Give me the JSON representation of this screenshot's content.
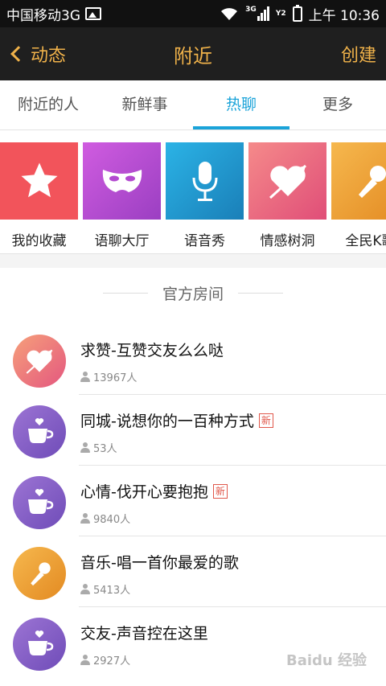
{
  "status": {
    "carrier": "中国移动3G",
    "time": "上午 10:36",
    "net_top": "3G",
    "net2": "Y2"
  },
  "header": {
    "back_label": "动态",
    "title": "附近",
    "create_label": "创建"
  },
  "tabs": [
    {
      "label": "附近的人"
    },
    {
      "label": "新鲜事"
    },
    {
      "label": "热聊"
    },
    {
      "label": "更多"
    }
  ],
  "categories": [
    {
      "label": "我的收藏",
      "color": "#f2545b",
      "icon": "star-icon"
    },
    {
      "label": "语聊大厅",
      "color": "#c04fd6",
      "icon": "mask-icon"
    },
    {
      "label": "语音秀",
      "color": "#21a5d8",
      "icon": "microphone-icon"
    },
    {
      "label": "情感树洞",
      "color": "#f06a7d",
      "icon": "heart-arrow-icon"
    },
    {
      "label": "全民K歌",
      "color": "#f0a63a",
      "icon": "karaoke-mic-icon"
    }
  ],
  "section": {
    "title": "官方房间"
  },
  "rooms": [
    {
      "name": "求赞-互赞交友么么哒",
      "count": "13967人",
      "is_new": false,
      "color": "#f0837e",
      "icon": "heart-arrow-icon"
    },
    {
      "name": "同城-说想你的一百种方式",
      "count": "53人",
      "is_new": true,
      "new_label": "新",
      "color": "#8a63c8",
      "icon": "coffee-cup-icon"
    },
    {
      "name": "心情-伐开心要抱抱",
      "count": "9840人",
      "is_new": true,
      "new_label": "新",
      "color": "#8a63c8",
      "icon": "coffee-cup-icon"
    },
    {
      "name": "音乐-唱一首你最爱的歌",
      "count": "5413人",
      "is_new": false,
      "color": "#f0a63a",
      "icon": "microphone-icon"
    },
    {
      "name": "交友-声音控在这里",
      "count": "2927人",
      "is_new": false,
      "color": "#8a63c8",
      "icon": "coffee-cup-icon"
    }
  ],
  "watermark": "Baidu 经验"
}
